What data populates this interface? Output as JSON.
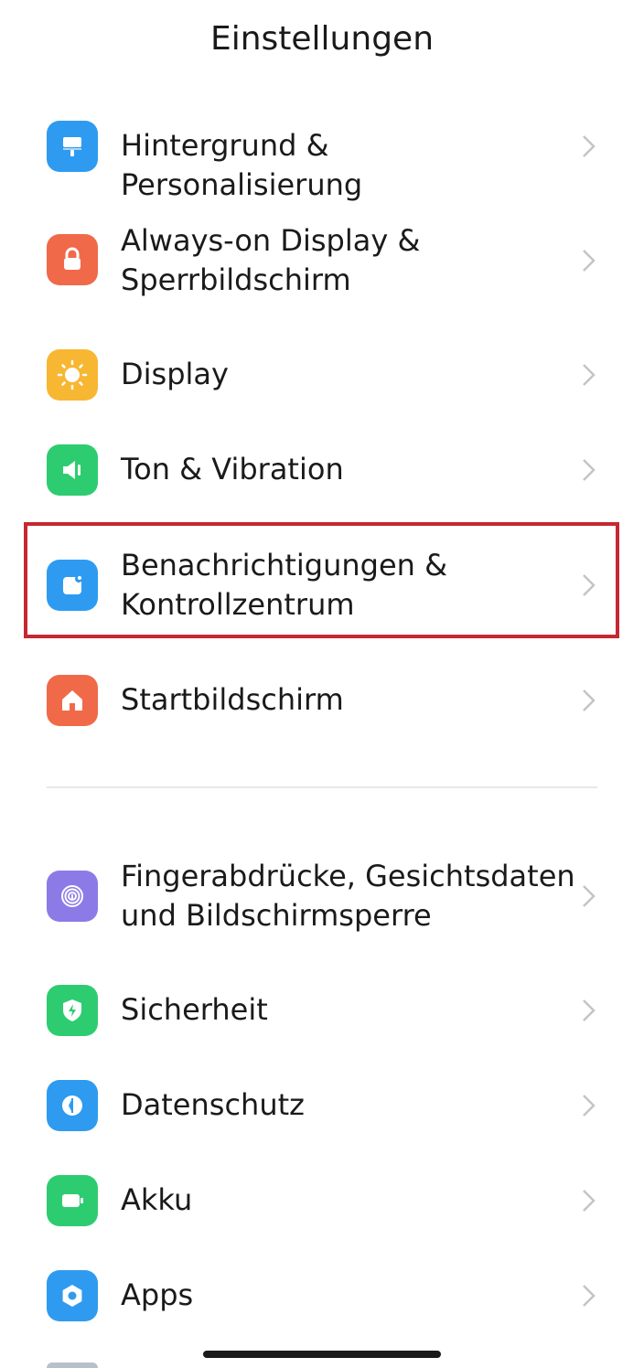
{
  "header": {
    "title": "Einstellungen"
  },
  "highlight_color": "#c62832",
  "items": [
    {
      "id": "wallpaper",
      "label": "Hintergrund & Personalisierung",
      "icon": "paintbrush-icon",
      "color": "#2e9bf0"
    },
    {
      "id": "lockscreen",
      "label": "Always-on Display &\nSperrbildschirm",
      "icon": "lock-icon",
      "color": "#f06a4a"
    },
    {
      "id": "display",
      "label": "Display",
      "icon": "sun-icon",
      "color": "#f7b733"
    },
    {
      "id": "sound",
      "label": "Ton & Vibration",
      "icon": "speaker-icon",
      "color": "#2ecc71"
    },
    {
      "id": "notifications",
      "label": "Benachrichtigungen &\nKontrollzentrum",
      "icon": "notification-icon",
      "color": "#2e9bf0"
    },
    {
      "id": "home",
      "label": "Startbildschirm",
      "icon": "home-icon",
      "color": "#f06a4a"
    },
    {
      "id": "biometrics",
      "label": "Fingerabdrücke, Gesichtsdaten\nund Bildschirmsperre",
      "icon": "fingerprint-icon",
      "color": "#8c7be6"
    },
    {
      "id": "security",
      "label": "Sicherheit",
      "icon": "shield-icon",
      "color": "#2ecc71"
    },
    {
      "id": "privacy",
      "label": "Datenschutz",
      "icon": "privacy-icon",
      "color": "#2e9bf0"
    },
    {
      "id": "battery",
      "label": "Akku",
      "icon": "battery-icon",
      "color": "#2ecc71"
    },
    {
      "id": "apps",
      "label": "Apps",
      "icon": "gear-icon",
      "color": "#2e9bf0"
    }
  ]
}
